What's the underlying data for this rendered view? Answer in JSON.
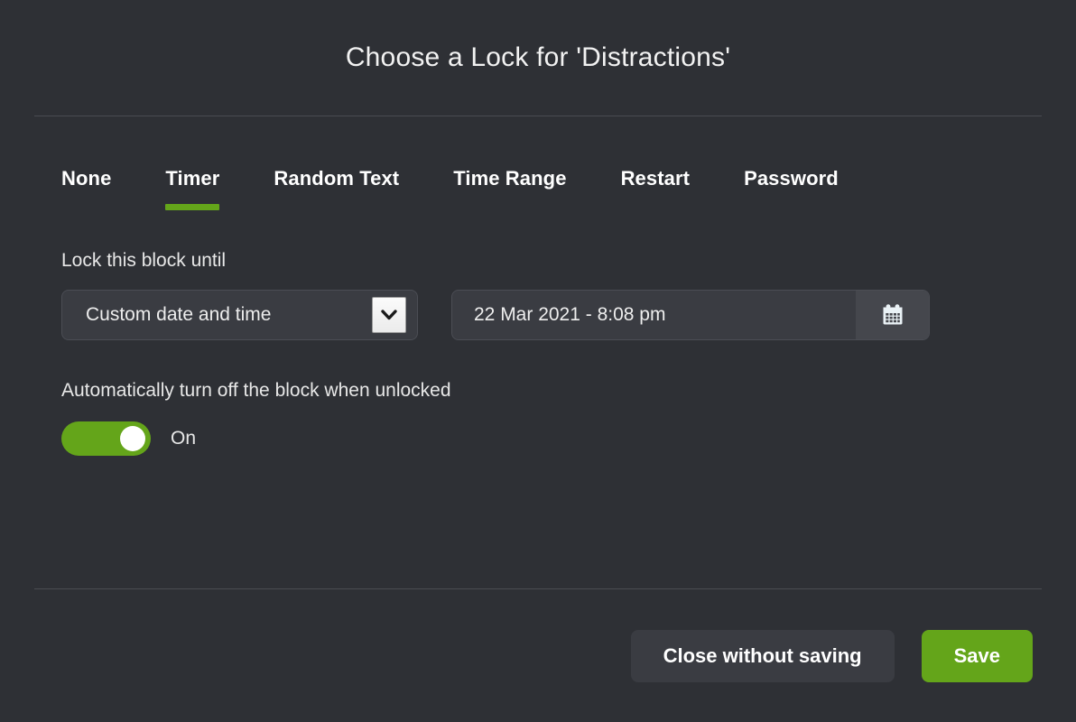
{
  "header": {
    "title": "Choose a Lock for 'Distractions'"
  },
  "tabs": [
    {
      "label": "None",
      "active": false
    },
    {
      "label": "Timer",
      "active": true
    },
    {
      "label": "Random Text",
      "active": false
    },
    {
      "label": "Time Range",
      "active": false
    },
    {
      "label": "Restart",
      "active": false
    },
    {
      "label": "Password",
      "active": false
    }
  ],
  "form": {
    "lock_until_label": "Lock this block until",
    "mode_select": {
      "value": "Custom date and time",
      "arrow_icon": "chevron-down-icon"
    },
    "date_field": {
      "value": "22 Mar 2021 - 8:08 pm",
      "calendar_icon": "calendar-icon"
    },
    "auto_off_label": "Automatically turn off the block when unlocked",
    "auto_off_toggle": {
      "state_label": "On",
      "enabled": true
    }
  },
  "footer": {
    "close_label": "Close without saving",
    "save_label": "Save"
  },
  "colors": {
    "background": "#2e3035",
    "surface": "#3a3c42",
    "accent_green": "#64a51a",
    "divider": "#4a4c52",
    "text": "#ffffff"
  }
}
